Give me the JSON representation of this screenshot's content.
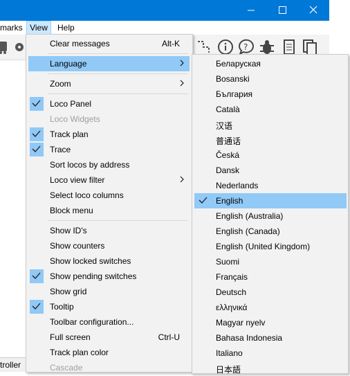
{
  "menubar": {
    "bookmarks": "marks",
    "view": "View",
    "help": "Help"
  },
  "statusbar": {
    "label": "troller"
  },
  "view_menu": {
    "items": [
      {
        "label": "Clear messages",
        "accel": "Alt-K"
      },
      {
        "label": "Language"
      },
      {
        "label": "Zoom"
      },
      {
        "label": "Loco Panel"
      },
      {
        "label": "Loco Widgets"
      },
      {
        "label": "Track plan"
      },
      {
        "label": "Trace"
      },
      {
        "label": "Sort locos by address"
      },
      {
        "label": "Loco view filter"
      },
      {
        "label": "Select loco columns"
      },
      {
        "label": "Block menu"
      },
      {
        "label": "Show ID's"
      },
      {
        "label": "Show counters"
      },
      {
        "label": "Show locked switches"
      },
      {
        "label": "Show pending switches"
      },
      {
        "label": "Show grid"
      },
      {
        "label": "Tooltip"
      },
      {
        "label": "Toolbar configuration..."
      },
      {
        "label": "Full screen",
        "accel": "Ctrl-U"
      },
      {
        "label": "Track plan color"
      },
      {
        "label": "Cascade"
      }
    ]
  },
  "language_menu": {
    "items": [
      "Беларуская",
      "Bosanski",
      "България",
      "Català",
      "汉语",
      "普通话",
      "Česká",
      "Dansk",
      "Nederlands",
      "English",
      "English (Australia)",
      "English (Canada)",
      "English (United Kingdom)",
      "Suomi",
      "Français",
      "Deutsch",
      "ελληνικά",
      "Magyar nyelv",
      "Bahasa Indonesia",
      "Italiano",
      "日本語"
    ],
    "selected": "English"
  },
  "colors": {
    "titlebar": "#0078d7",
    "highlight": "#91c9f7",
    "menu_bg": "#f2f2f2"
  }
}
